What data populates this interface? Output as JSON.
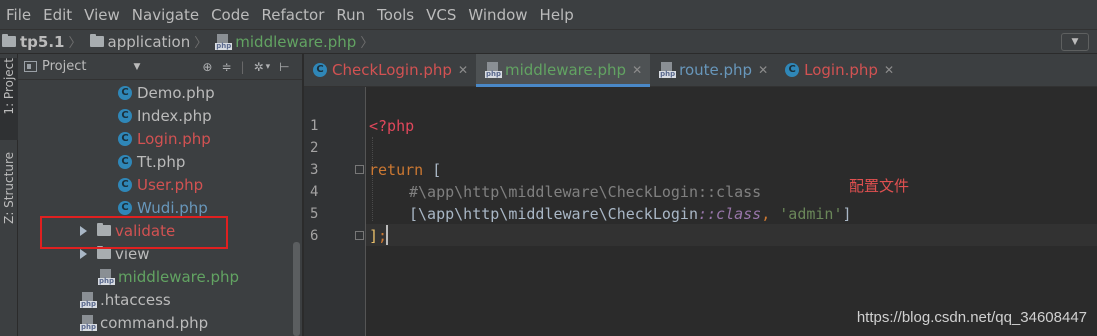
{
  "menubar": {
    "items": [
      "File",
      "Edit",
      "View",
      "Navigate",
      "Code",
      "Refactor",
      "Run",
      "Tools",
      "VCS",
      "Window",
      "Help"
    ]
  },
  "navbar": {
    "crumbs": [
      "tp5.1",
      "application",
      "middleware.php"
    ],
    "dropdown_icon": "caret-down-icon"
  },
  "left_strip": {
    "project_tab": "1: Project",
    "structure_tab": "Z: Structure"
  },
  "project_panel": {
    "title": "Project",
    "tree": [
      {
        "label": "Demo.php",
        "icon": "php-class-icon",
        "color": "#bbbbbb"
      },
      {
        "label": "Index.php",
        "icon": "php-class-icon",
        "color": "#bbbbbb"
      },
      {
        "label": "Login.php",
        "icon": "php-class-icon",
        "color": "#d25252"
      },
      {
        "label": "Tt.php",
        "icon": "php-class-icon",
        "color": "#bbbbbb"
      },
      {
        "label": "User.php",
        "icon": "php-class-icon",
        "color": "#d25252"
      },
      {
        "label": "Wudi.php",
        "icon": "php-class-icon",
        "color": "#6897bb"
      },
      {
        "label": "validate",
        "icon": "folder-icon",
        "color": "#d25252"
      },
      {
        "label": "view",
        "icon": "folder-icon",
        "color": "#bbbbbb"
      },
      {
        "label": "middleware.php",
        "icon": "php-file-icon",
        "color": "#62a362"
      },
      {
        "label": ".htaccess",
        "icon": "file-icon",
        "color": "#bbbbbb"
      },
      {
        "label": "command.php",
        "icon": "php-file-icon",
        "color": "#bbbbbb"
      }
    ]
  },
  "tabs": [
    {
      "label": "CheckLogin.php",
      "color": "#d25252",
      "icon": "php-class-icon",
      "active": false
    },
    {
      "label": "middleware.php",
      "color": "#62a362",
      "icon": "php-file-icon",
      "active": true
    },
    {
      "label": "route.php",
      "color": "#6897bb",
      "icon": "php-file-icon",
      "active": false
    },
    {
      "label": "Login.php",
      "color": "#d25252",
      "icon": "php-class-icon",
      "active": false
    }
  ],
  "editor": {
    "line_numbers": [
      "1",
      "2",
      "3",
      "4",
      "5",
      "6"
    ],
    "lines": {
      "l1": "<?php",
      "l3_kw": "return",
      "l3_rest": " [",
      "l4": "#\\app\\http\\middleware\\CheckLogin::class",
      "l5_a": "[\\app\\http\\middleware\\CheckLogin",
      "l5_b": "::",
      "l5_c": "class",
      "l5_d": ", ",
      "l5_e": "'admin'",
      "l5_f": "]",
      "l6_a": "]",
      "l6_b": ";"
    },
    "annotation": "配置文件"
  },
  "watermark": "https://blog.csdn.net/qq_34608447"
}
